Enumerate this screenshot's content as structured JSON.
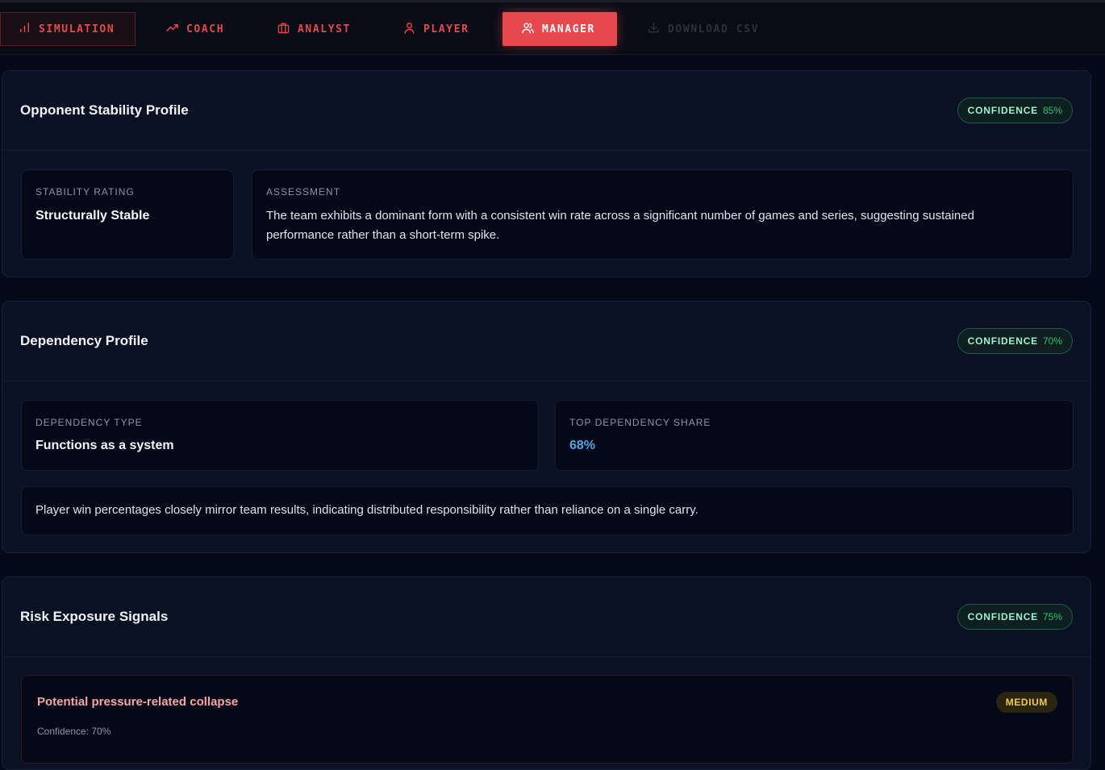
{
  "nav": {
    "tabs": [
      {
        "label": "SIMULATION",
        "icon": "bar-chart-icon"
      },
      {
        "label": "COACH",
        "icon": "trending-up-icon"
      },
      {
        "label": "ANALYST",
        "icon": "briefcase-icon"
      },
      {
        "label": "PLAYER",
        "icon": "user-icon"
      },
      {
        "label": "MANAGER",
        "icon": "users-icon",
        "active": true
      },
      {
        "label": "DOWNLOAD CSV",
        "icon": "download-icon",
        "disabled": true
      }
    ]
  },
  "colors": {
    "accent": "#e5484d",
    "confidence": "#27c36c",
    "blue_value": "#4aa8e8",
    "severity_medium": "#f2c94c"
  },
  "stability": {
    "title": "Opponent Stability Profile",
    "confidence_label": "CONFIDENCE",
    "confidence_value": "85%",
    "rating_label": "STABILITY RATING",
    "rating_value": "Structurally Stable",
    "assessment_label": "ASSESSMENT",
    "assessment_text": "The team exhibits a dominant form with a consistent win rate across a significant number of games and series, suggesting sustained performance rather than a short-term spike."
  },
  "dependency": {
    "title": "Dependency Profile",
    "confidence_label": "CONFIDENCE",
    "confidence_value": "70%",
    "type_label": "DEPENDENCY TYPE",
    "type_value": "Functions as a system",
    "share_label": "TOP DEPENDENCY SHARE",
    "share_value": "68%",
    "note": "Player win percentages closely mirror team results, indicating distributed responsibility rather than reliance on a single carry."
  },
  "risk": {
    "title": "Risk Exposure Signals",
    "confidence_label": "CONFIDENCE",
    "confidence_value": "75%",
    "items": [
      {
        "title": "Potential pressure-related collapse",
        "confidence": "Confidence: 70%",
        "severity": "MEDIUM"
      }
    ]
  }
}
